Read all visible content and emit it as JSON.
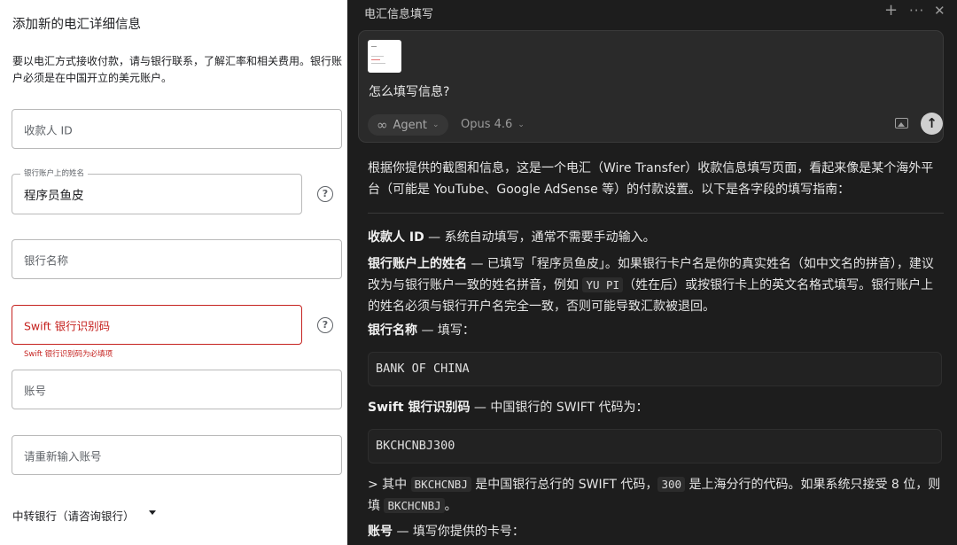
{
  "form": {
    "title": "添加新的电汇详细信息",
    "description": "要以电汇方式接收付款，请与银行联系，了解汇率和相关费用。银行账户必须是在中国开立的美元账户。",
    "payee_id_placeholder": "收款人 ID",
    "account_name_label": "银行账户上的姓名",
    "account_name_value": "程序员鱼皮",
    "bank_name_placeholder": "银行名称",
    "swift_placeholder": "Swift 银行识别码",
    "swift_error": "Swift 银行识别码为必填项",
    "account_number_placeholder": "账号",
    "account_number_confirm_placeholder": "请重新输入账号",
    "intermediary_label": "中转银行（请咨询银行）",
    "help_glyph": "?"
  },
  "chat": {
    "title": "电汇信息填写",
    "icons": {
      "new": "plus-icon",
      "more": "more-icon",
      "close": "close-icon"
    },
    "composer": {
      "question": "怎么填写信息?",
      "agent_label": "Agent",
      "model_label": "Opus 4.6"
    },
    "response": {
      "intro": "根据你提供的截图和信息，这是一个电汇（Wire Transfer）收款信息填写页面，看起来像是某个海外平台（可能是 YouTube、Google AdSense 等）的付款设置。以下是各字段的填写指南：",
      "payee_heading": "收款人 ID",
      "payee_text": " — 系统自动填写，通常不需要手动输入。",
      "name_heading": "银行账户上的姓名",
      "name_text_1": " — 已填写「程序员鱼皮」。如果银行卡户名是你的真实姓名（如中文名的拼音），建议改为与银行账户一致的姓名拼音，例如 ",
      "name_code": "YU PI",
      "name_text_2": "（姓在后）或按银行卡上的英文名格式填写。银行账户上的姓名必须与银行开户名完全一致，否则可能导致汇款被退回。",
      "bank_heading": "银行名称",
      "bank_text": " — 填写：",
      "bank_code": "BANK OF CHINA",
      "swift_heading": "Swift 银行识别码",
      "swift_text": " — 中国银行的 SWIFT 代码为：",
      "swift_code": "BKCHCNBJ300",
      "note_1": "> 其中 ",
      "note_code_1": "BKCHCNBJ",
      "note_2": " 是中国银行总行的 SWIFT 代码，",
      "note_code_2": "300",
      "note_3": " 是上海分行的代码。如果系统只接受 8 位，则填 ",
      "note_code_3": "BKCHCNBJ",
      "note_4": "。",
      "account_heading": "账号",
      "account_text": " — 填写你提供的卡号："
    }
  },
  "colors": {
    "error": "#c5221f",
    "chat_bg": "#1d1d1d",
    "composer_bg": "#2a2a2a"
  }
}
